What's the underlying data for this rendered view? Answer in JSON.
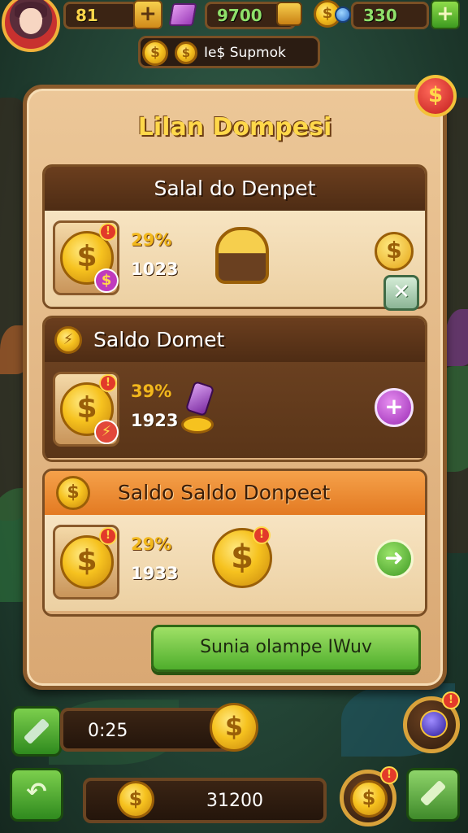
{
  "hud": {
    "resource_1": "81",
    "resource_2": "9700",
    "resource_3": "330",
    "plus_symbol": "+",
    "subtitle": "Ie$ Supmok"
  },
  "panel": {
    "title": "Lilan Dompesi",
    "close_symbol": "$",
    "sections": [
      {
        "title": "Salal do Denpet",
        "percent": "29%",
        "value": "1023",
        "action_symbol": "$"
      },
      {
        "title": "Saldo Domet",
        "percent": "39%",
        "value": "1923",
        "action_symbol": "+"
      },
      {
        "title": "Saldo Saldo Donpeet",
        "percent": "29%",
        "value": "1933",
        "action_symbol": "➜"
      }
    ],
    "close_card_symbol": "✕",
    "cta_label": "Sunia olampe IWuv"
  },
  "bottom": {
    "timer": "0:25",
    "balance": "31200"
  },
  "colors": {
    "gold": "#f6c21f",
    "panel": "#ecc798",
    "panel_border": "#8a5a2b",
    "header_brown": "#6b3e1e",
    "header_orange": "#f5a14a",
    "button_green": "#4fae2c",
    "close_red": "#c21d1d"
  },
  "icons": {
    "avatar": "player-avatar",
    "gem": "purple-gem-icon",
    "coin": "dollar-coin-icon",
    "chest": "treasure-chest-icon",
    "tool": "wrench-icon",
    "potion": "blue-orb-icon"
  }
}
